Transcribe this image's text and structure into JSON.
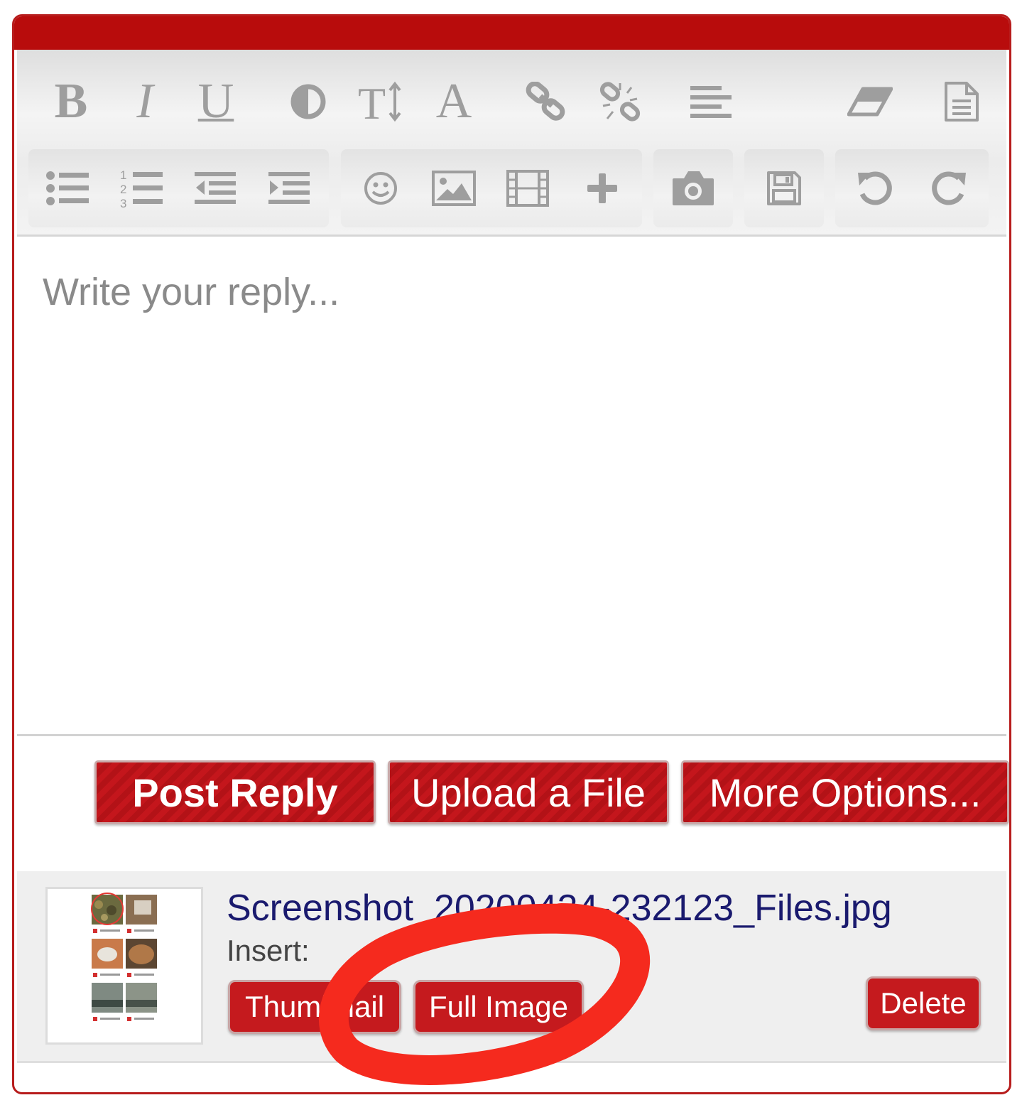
{
  "toolbar": {
    "row1": [
      {
        "name": "bold-button",
        "glyph": "B"
      },
      {
        "name": "italic-button",
        "glyph": "I"
      },
      {
        "name": "underline-button",
        "glyph": "U"
      },
      {
        "name": "color-contrast-button",
        "icon": "contrast-icon"
      },
      {
        "name": "font-size-button",
        "glyph": "T↕"
      },
      {
        "name": "font-button",
        "glyph": "A"
      },
      {
        "name": "insert-link-button",
        "icon": "link-icon"
      },
      {
        "name": "remove-link-button",
        "icon": "unlink-icon"
      },
      {
        "name": "align-button",
        "icon": "align-icon"
      },
      {
        "name": "remove-format-button",
        "icon": "eraser-icon"
      },
      {
        "name": "source-button",
        "icon": "document-icon"
      }
    ],
    "row2": [
      {
        "name": "bulleted-list-button",
        "icon": "bullet-list-icon"
      },
      {
        "name": "numbered-list-button",
        "icon": "numbered-list-icon"
      },
      {
        "name": "outdent-button",
        "icon": "outdent-icon"
      },
      {
        "name": "indent-button",
        "icon": "indent-icon"
      },
      {
        "name": "smilies-button",
        "icon": "smiley-icon"
      },
      {
        "name": "insert-image-button",
        "icon": "image-icon"
      },
      {
        "name": "insert-media-button",
        "icon": "film-icon"
      },
      {
        "name": "insert-more-button",
        "icon": "plus-icon"
      },
      {
        "name": "camera-button",
        "icon": "camera-icon"
      },
      {
        "name": "save-draft-button",
        "icon": "floppy-icon"
      },
      {
        "name": "undo-button",
        "icon": "undo-icon"
      },
      {
        "name": "redo-button",
        "icon": "redo-icon"
      }
    ]
  },
  "editor": {
    "placeholder": "Write your reply..."
  },
  "actions": {
    "post_reply": "Post Reply",
    "upload_file": "Upload a File",
    "more_options": "More Options..."
  },
  "attachment": {
    "file_name": "Screenshot_20200424-232123_Files.jpg",
    "insert_label": "Insert:",
    "thumbnail_button": "Thumbnail",
    "full_image_button": "Full Image",
    "delete_button": "Delete"
  },
  "colors": {
    "brand_red": "#b80c0c",
    "button_red": "#c4161c",
    "annotation_red": "#f52a1e",
    "icon_gray": "#9e9e9e",
    "link_navy": "#1a1a6e"
  }
}
